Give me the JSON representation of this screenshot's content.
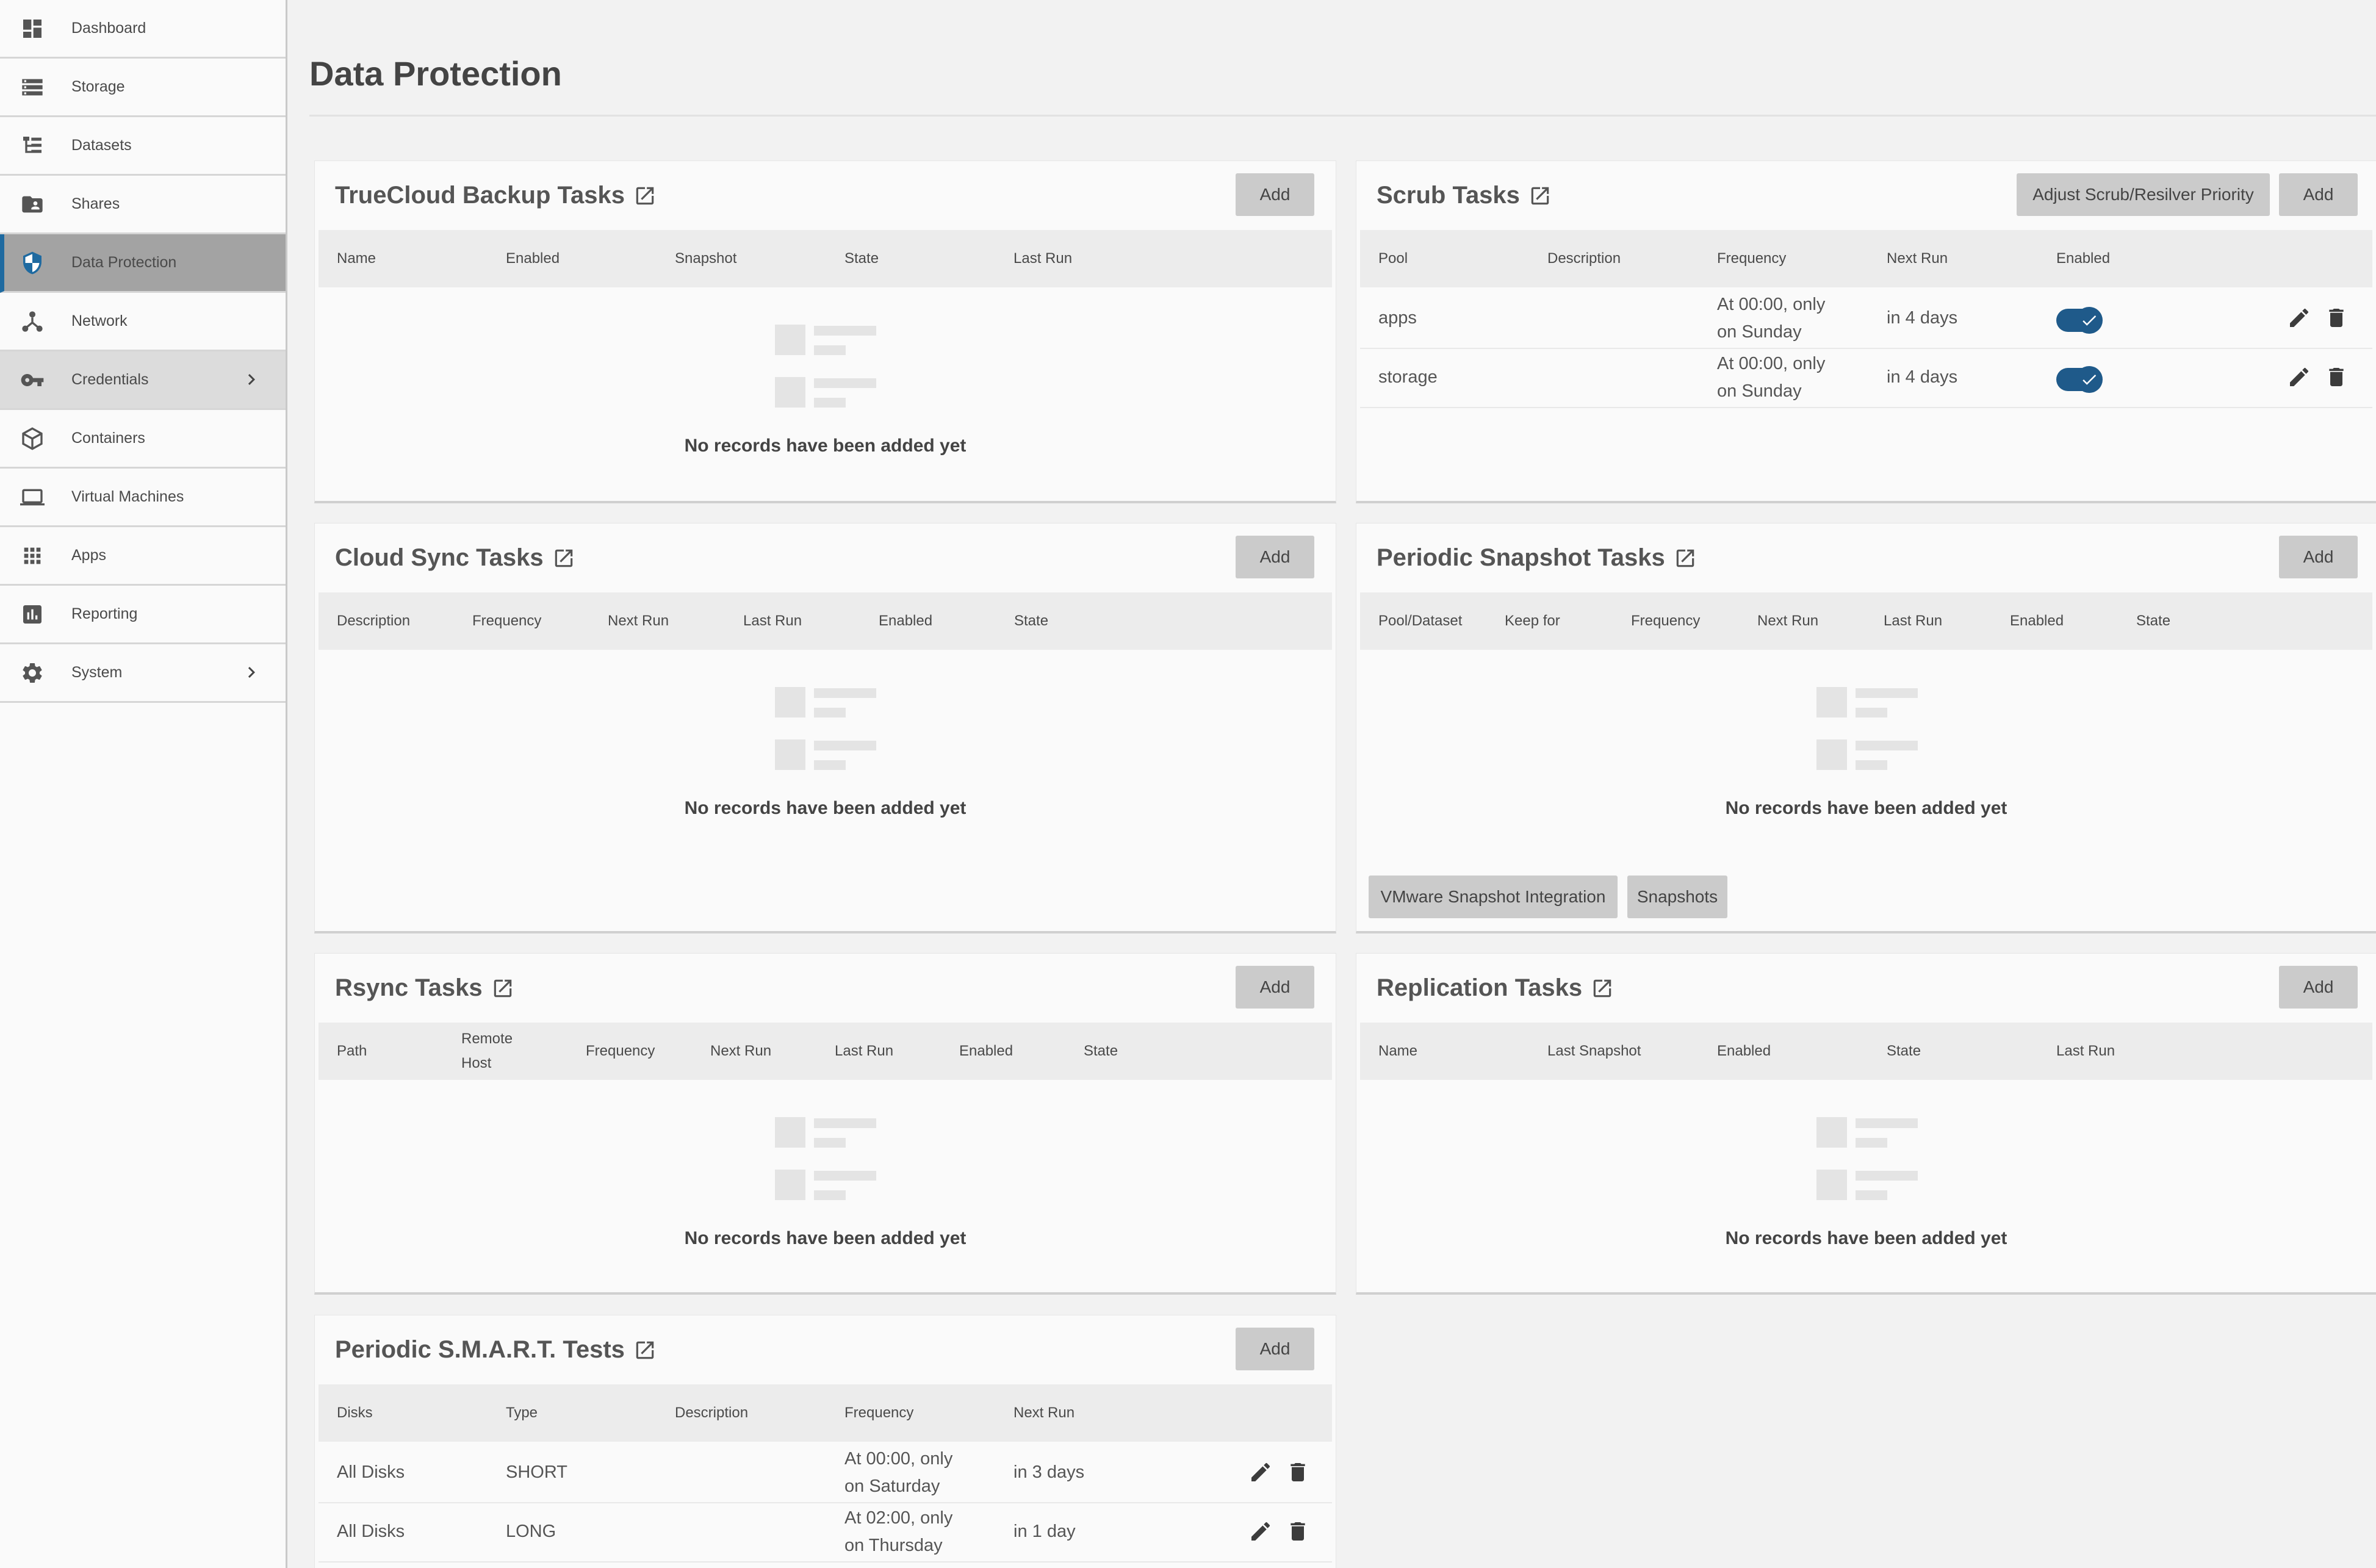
{
  "sidebar": {
    "items": [
      {
        "label": "Dashboard",
        "icon": "dashboard-icon"
      },
      {
        "label": "Storage",
        "icon": "storage-icon"
      },
      {
        "label": "Datasets",
        "icon": "datasets-icon"
      },
      {
        "label": "Shares",
        "icon": "shares-icon"
      },
      {
        "label": "Data Protection",
        "icon": "shield-icon"
      },
      {
        "label": "Network",
        "icon": "network-icon"
      },
      {
        "label": "Credentials",
        "icon": "key-icon"
      },
      {
        "label": "Containers",
        "icon": "box-icon"
      },
      {
        "label": "Virtual Machines",
        "icon": "laptop-icon"
      },
      {
        "label": "Apps",
        "icon": "apps-grid-icon"
      },
      {
        "label": "Reporting",
        "icon": "chart-icon"
      },
      {
        "label": "System",
        "icon": "gear-icon"
      }
    ]
  },
  "header": {
    "title": "Data Protection"
  },
  "empty_message": "No records have been added yet",
  "add_label": "Add",
  "cards": {
    "truecloud": {
      "title": "TrueCloud Backup Tasks",
      "columns": [
        "Name",
        "Enabled",
        "Snapshot",
        "State",
        "Last Run"
      ]
    },
    "scrub": {
      "title": "Scrub Tasks",
      "priority_label": "Adjust Scrub/Resilver Priority",
      "columns": [
        "Pool",
        "Description",
        "Frequency",
        "Next Run",
        "Enabled"
      ],
      "rows": [
        {
          "pool": "apps",
          "description": "",
          "freq1": "At 00:00, only",
          "freq2": "on Sunday",
          "next": "in 4 days",
          "enabled": true
        },
        {
          "pool": "storage",
          "description": "",
          "freq1": "At 00:00, only",
          "freq2": "on Sunday",
          "next": "in 4 days",
          "enabled": true
        }
      ]
    },
    "cloudsync": {
      "title": "Cloud Sync Tasks",
      "columns": [
        "Description",
        "Frequency",
        "Next Run",
        "Last Run",
        "Enabled",
        "State"
      ]
    },
    "snapshot": {
      "title": "Periodic Snapshot Tasks",
      "columns": [
        "Pool/Dataset",
        "Keep for",
        "Frequency",
        "Next Run",
        "Last Run",
        "Enabled",
        "State"
      ],
      "vmware_label": "VMware Snapshot Integration",
      "snapshots_label": "Snapshots"
    },
    "rsync": {
      "title": "Rsync Tasks",
      "columns": [
        "Path",
        "Remote",
        "Host",
        "Frequency",
        "Next Run",
        "Last Run",
        "Enabled",
        "State"
      ]
    },
    "replication": {
      "title": "Replication Tasks",
      "columns": [
        "Name",
        "Last Snapshot",
        "Enabled",
        "State",
        "Last Run"
      ]
    },
    "smart": {
      "title": "Periodic S.M.A.R.T. Tests",
      "columns": [
        "Disks",
        "Type",
        "Description",
        "Frequency",
        "Next Run"
      ],
      "rows": [
        {
          "disks": "All Disks",
          "type": "SHORT",
          "description": "",
          "freq1": "At 00:00, only",
          "freq2": "on Saturday",
          "next": "in 3 days"
        },
        {
          "disks": "All Disks",
          "type": "LONG",
          "description": "",
          "freq1": "At 02:00, only",
          "freq2": "on Thursday",
          "next": "in 1 day"
        }
      ]
    }
  }
}
